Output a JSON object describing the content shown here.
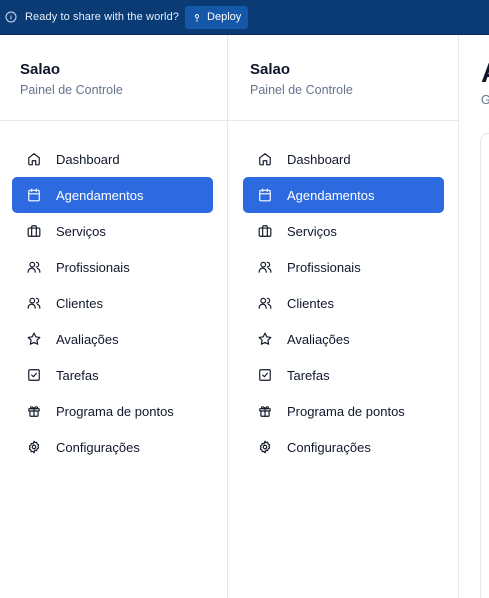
{
  "banner": {
    "message": "Ready to share with the world?",
    "deploy_label": "Deploy",
    "icons": {
      "info": "info-icon",
      "deploy": "deploy-icon"
    },
    "colors": {
      "background": "#0b3b75",
      "button": "#1557a8"
    }
  },
  "sidebars": [
    {
      "brand": {
        "name": "Salao",
        "subtitle": "Painel de Controle"
      },
      "items": [
        {
          "label": "Dashboard",
          "icon": "home-icon",
          "active": false
        },
        {
          "label": "Agendamentos",
          "icon": "calendar-icon",
          "active": true
        },
        {
          "label": "Serviços",
          "icon": "briefcase-icon",
          "active": false
        },
        {
          "label": "Profissionais",
          "icon": "users-icon",
          "active": false
        },
        {
          "label": "Clientes",
          "icon": "users-icon",
          "active": false
        },
        {
          "label": "Avaliações",
          "icon": "star-icon",
          "active": false
        },
        {
          "label": "Tarefas",
          "icon": "check-square-icon",
          "active": false
        },
        {
          "label": "Programa de pontos",
          "icon": "gift-icon",
          "active": false
        },
        {
          "label": "Configurações",
          "icon": "gear-icon",
          "active": false
        }
      ]
    },
    {
      "brand": {
        "name": "Salao",
        "subtitle": "Painel de Controle"
      },
      "items": [
        {
          "label": "Dashboard",
          "icon": "home-icon",
          "active": false
        },
        {
          "label": "Agendamentos",
          "icon": "calendar-icon",
          "active": true
        },
        {
          "label": "Serviços",
          "icon": "briefcase-icon",
          "active": false
        },
        {
          "label": "Profissionais",
          "icon": "users-icon",
          "active": false
        },
        {
          "label": "Clientes",
          "icon": "users-icon",
          "active": false
        },
        {
          "label": "Avaliações",
          "icon": "star-icon",
          "active": false
        },
        {
          "label": "Tarefas",
          "icon": "check-square-icon",
          "active": false
        },
        {
          "label": "Programa de pontos",
          "icon": "gift-icon",
          "active": false
        },
        {
          "label": "Configurações",
          "icon": "gear-icon",
          "active": false
        }
      ]
    }
  ],
  "main": {
    "title_fragment": "A",
    "subtitle_fragment": "G"
  },
  "colors": {
    "accent": "#2d6ae0",
    "muted_text": "#64748b",
    "border": "#e5e7eb"
  }
}
